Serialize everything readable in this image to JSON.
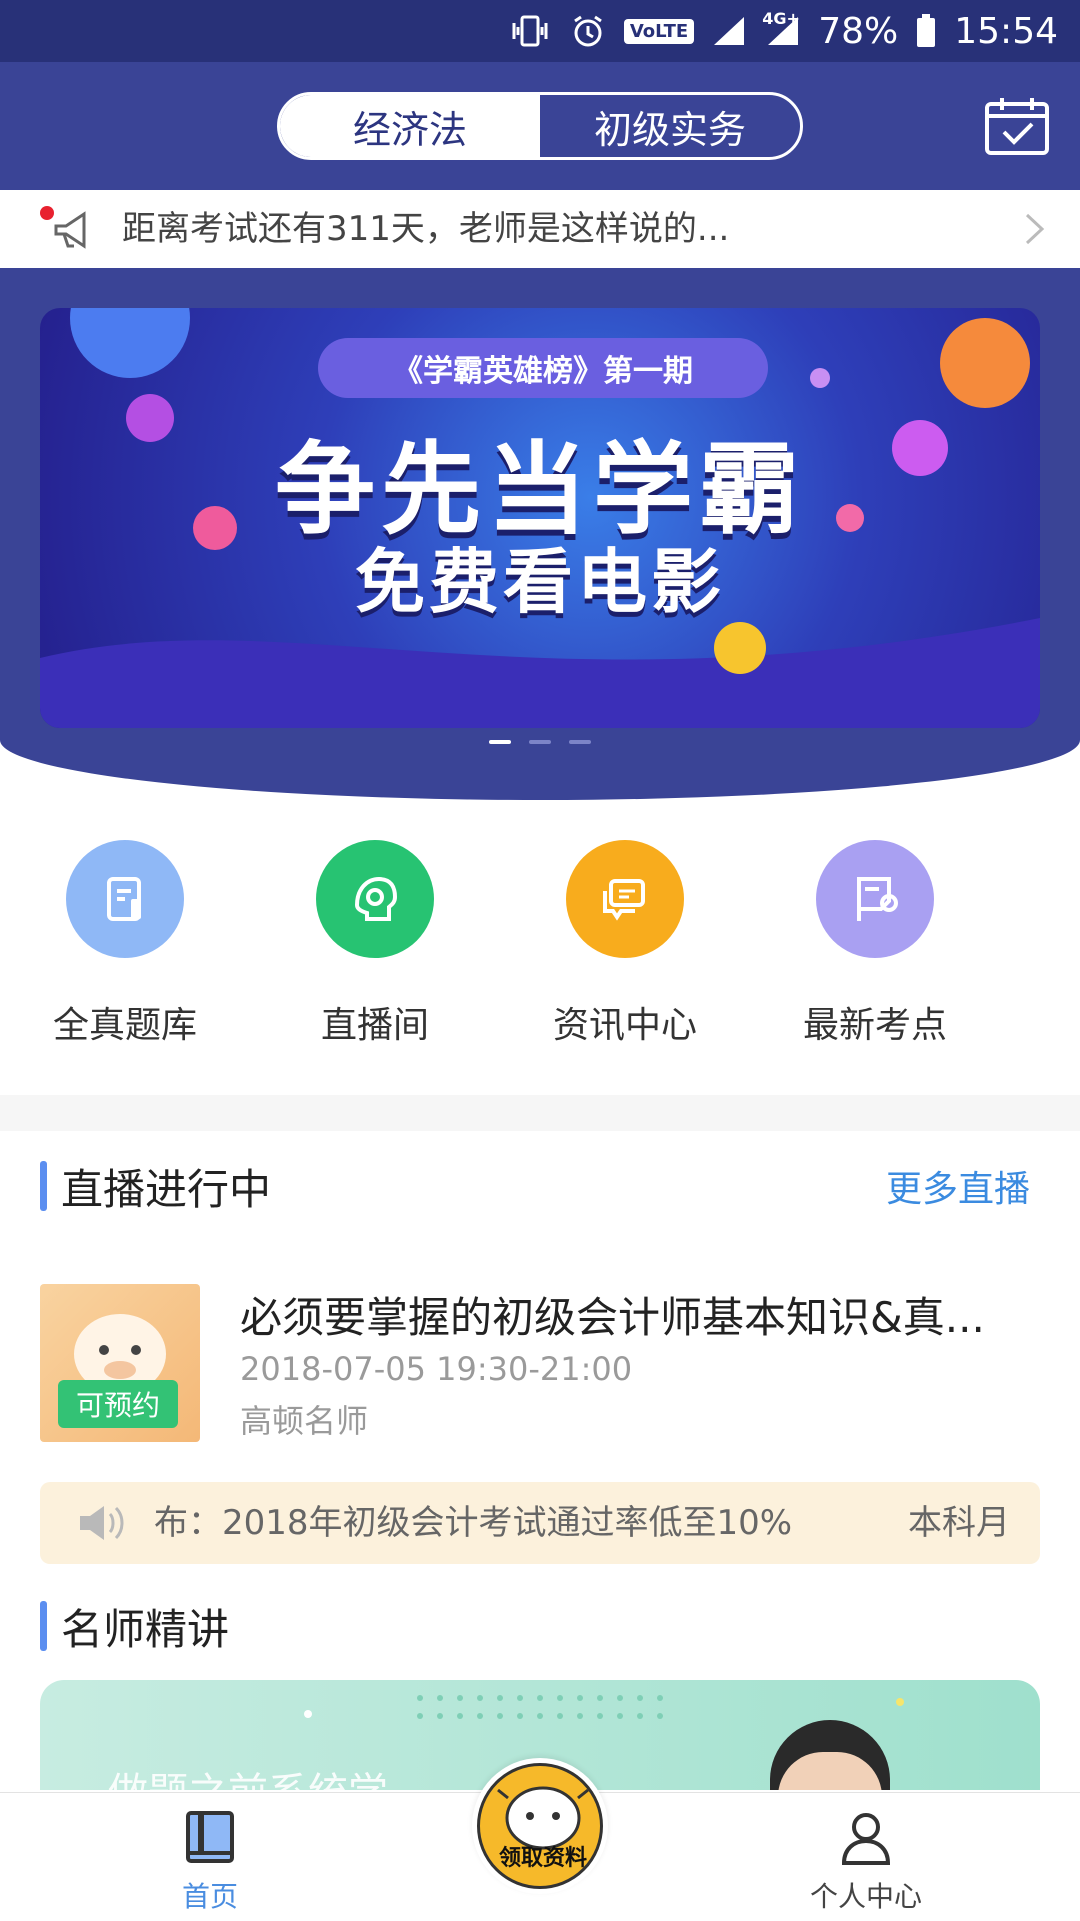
{
  "status_bar": {
    "network": "4G+",
    "volte": "VoLTE",
    "battery": "78%",
    "time": "15:54"
  },
  "header": {
    "tabs": [
      {
        "label": "经济法",
        "active": true
      },
      {
        "label": "初级实务",
        "active": false
      }
    ],
    "calendar_icon": "calendar-check-icon"
  },
  "notice": {
    "text": "距离考试还有311天，老师是这样说的..."
  },
  "banner": {
    "tag": "《学霸英雄榜》第一期",
    "headline": "争先当学霸",
    "subheadline": "免费看电影",
    "active_slide": 1,
    "slide_count": 3
  },
  "quick_entries": [
    {
      "label": "全真题库",
      "icon": "question-bank-icon",
      "color": "#8fb8f6"
    },
    {
      "label": "直播间",
      "icon": "live-room-icon",
      "color": "#27c372"
    },
    {
      "label": "资讯中心",
      "icon": "news-center-icon",
      "color": "#f8ac1d"
    },
    {
      "label": "最新考点",
      "icon": "exam-points-icon",
      "color": "#a9a0f2"
    }
  ],
  "live_section": {
    "title": "直播进行中",
    "more": "更多直播",
    "item": {
      "badge": "可预约",
      "title": "必须要掌握的初级会计师基本知识&真...",
      "time": "2018-07-05 19:30-21:00",
      "author": "高顿名师"
    }
  },
  "marquee": {
    "text1": "布：2018年初级会计考试通过率低至10%",
    "text2": "本科月"
  },
  "teacher_section": {
    "title": "名师精讲",
    "card_text": "做题之前系统学"
  },
  "bottom_nav": {
    "home": "首页",
    "center_label": "领取资料",
    "profile": "个人中心"
  },
  "colors": {
    "primary": "#3a4496",
    "accent_blue": "#3b8be0",
    "badge_green": "#33c275"
  }
}
